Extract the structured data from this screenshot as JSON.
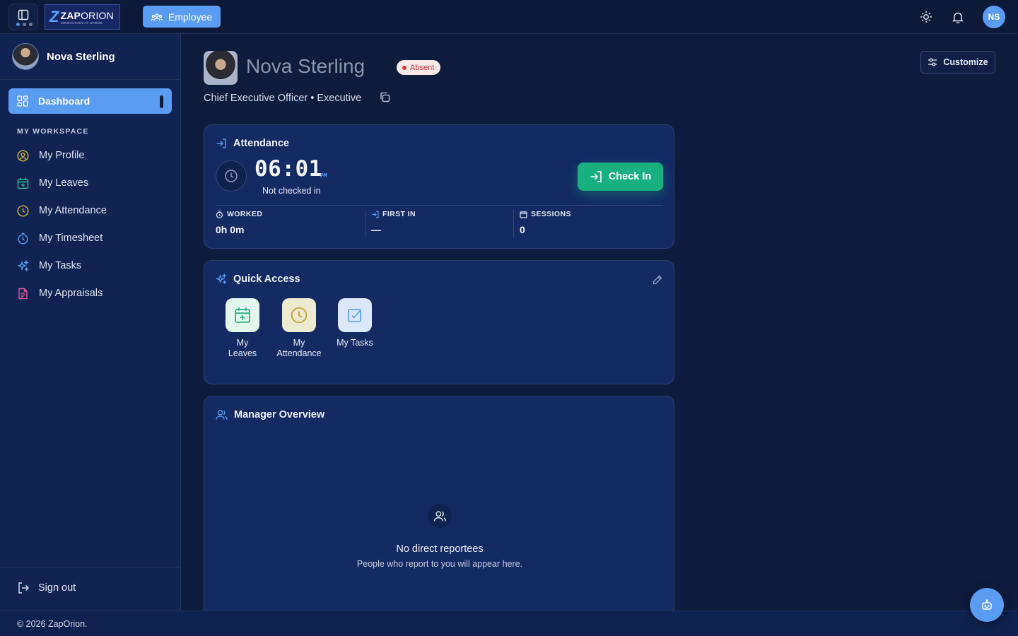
{
  "header": {
    "logo_name_bold": "ZAP",
    "logo_name_thin": "ORION",
    "logo_tagline": "INNOVATION AT SPEED",
    "role_button": "Employee",
    "avatar_initials": "NS"
  },
  "sidebar": {
    "user_name": "Nova Sterling",
    "active_item": "Dashboard",
    "section_title": "MY WORKSPACE",
    "items": [
      {
        "label": "My Profile",
        "icon": "user-circle-icon",
        "color": "#d9b63a"
      },
      {
        "label": "My Leaves",
        "icon": "calendar-plus-icon",
        "color": "#2cc08b"
      },
      {
        "label": "My Attendance",
        "icon": "clock-icon",
        "color": "#d9b63a"
      },
      {
        "label": "My Timesheet",
        "icon": "stopwatch-icon",
        "color": "#5b9cf3"
      },
      {
        "label": "My Tasks",
        "icon": "sparkles-icon",
        "color": "#5b9cf3"
      },
      {
        "label": "My Appraisals",
        "icon": "document-icon",
        "color": "#e05a9d"
      }
    ],
    "signout": "Sign out"
  },
  "profile": {
    "name": "Nova Sterling",
    "status": "Absent",
    "subtitle": "Chief Executive Officer • Executive",
    "customize": "Customize"
  },
  "attendance": {
    "title": "Attendance",
    "time": "06:01",
    "ampm": "PM",
    "status": "Not checked in",
    "checkin": "Check In",
    "stats": [
      {
        "label": "WORKED",
        "value": "0h 0m"
      },
      {
        "label": "FIRST IN",
        "value": "—"
      },
      {
        "label": "SESSIONS",
        "value": "0"
      }
    ]
  },
  "quick_access": {
    "title": "Quick Access",
    "items": [
      {
        "label": "My Leaves",
        "bg": "#e3f7ee",
        "color": "#2cb283"
      },
      {
        "label": "My Attendance",
        "bg": "#ecebd0",
        "color": "#c3a23a"
      },
      {
        "label": "My Tasks",
        "bg": "#dbe8fb",
        "color": "#5b9cf3"
      }
    ]
  },
  "manager": {
    "title": "Manager Overview",
    "empty_title": "No direct reportees",
    "empty_sub": "People who report to you will appear here."
  },
  "footer": {
    "copyright": "© 2026 ZapOrion."
  },
  "colors": {
    "accent": "#5b9cf3",
    "success": "#19b07f",
    "danger": "#d6393a",
    "background": "#0d1b3d"
  }
}
